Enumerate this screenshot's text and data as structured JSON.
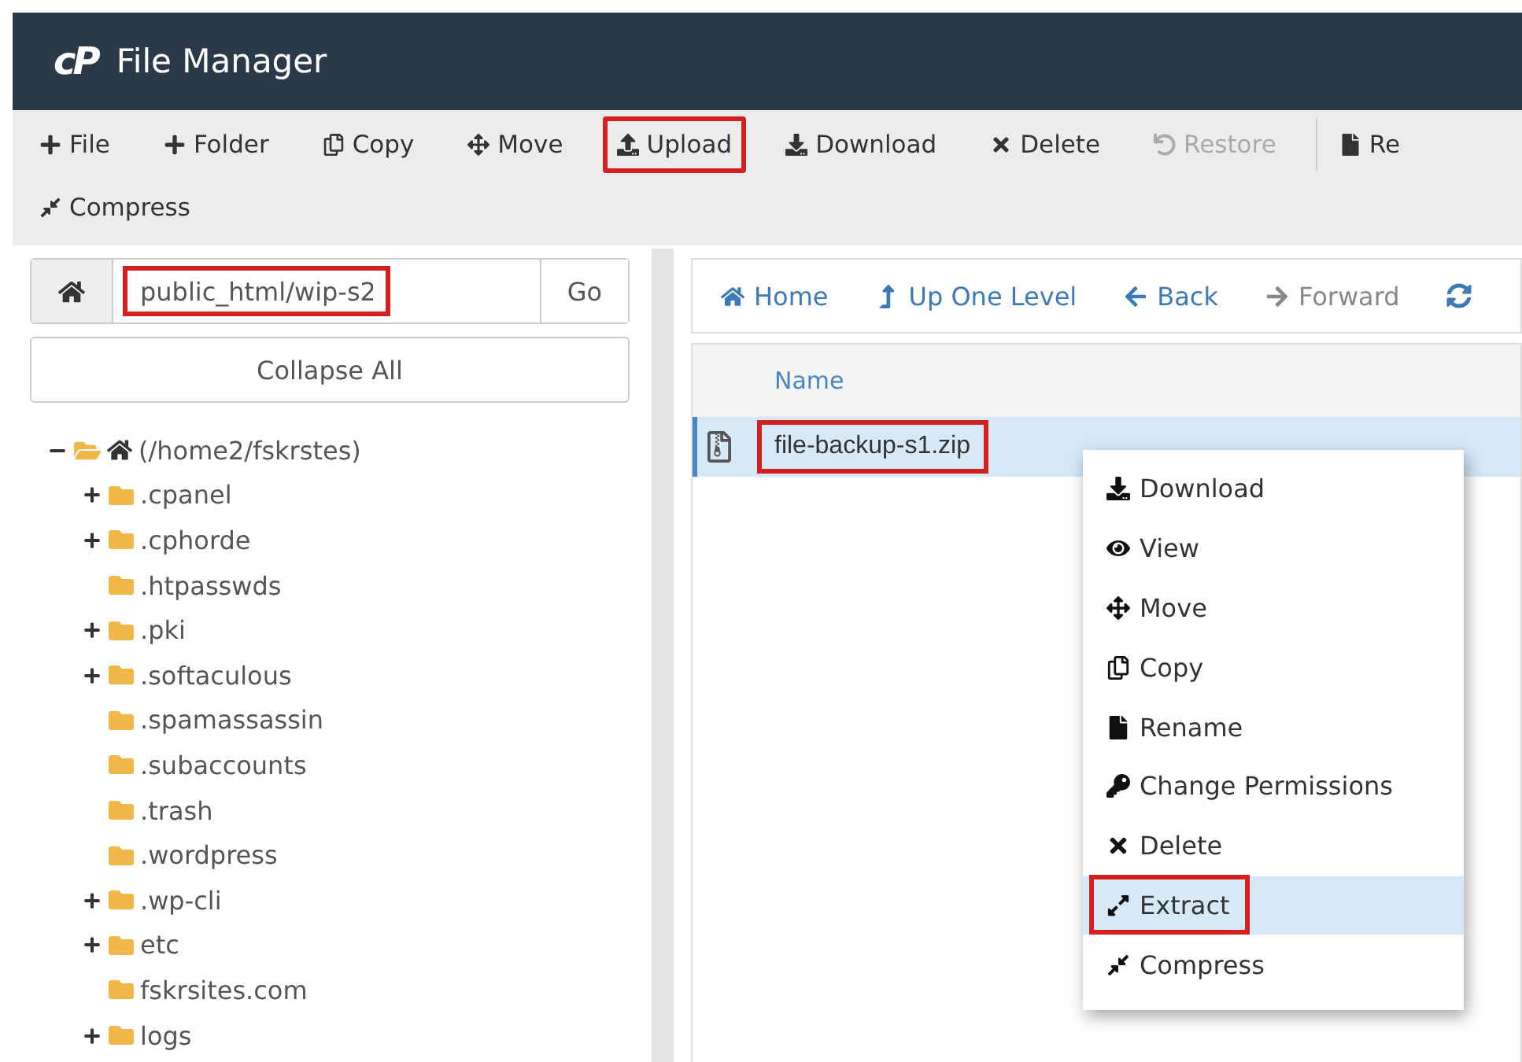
{
  "header": {
    "logo": "cP",
    "title": "File Manager"
  },
  "toolbar": [
    {
      "label": "File",
      "disabled": false,
      "highlighted": false
    },
    {
      "label": "Folder",
      "disabled": false,
      "highlighted": false
    },
    {
      "label": "Copy",
      "disabled": false,
      "highlighted": false
    },
    {
      "label": "Move",
      "disabled": false,
      "highlighted": false
    },
    {
      "label": "Upload",
      "disabled": false,
      "highlighted": true
    },
    {
      "label": "Download",
      "disabled": false,
      "highlighted": false
    },
    {
      "label": "Delete",
      "disabled": false,
      "highlighted": false
    },
    {
      "label": "Restore",
      "disabled": true,
      "highlighted": false
    },
    {
      "label": "Re",
      "disabled": false,
      "highlighted": false
    },
    {
      "label": "Compress",
      "disabled": false,
      "highlighted": false
    }
  ],
  "path": {
    "value": "public_html/wip-s2",
    "button": "Go",
    "highlighted": true
  },
  "collapse_button": "Collapse All",
  "tree": {
    "label": "(/home2/fskrstes)",
    "expanded": true,
    "children": [
      {
        "label": ".cpanel",
        "expandable": true
      },
      {
        "label": ".cphorde",
        "expandable": true
      },
      {
        "label": ".htpasswds",
        "expandable": false
      },
      {
        "label": ".pki",
        "expandable": true
      },
      {
        "label": ".softaculous",
        "expandable": true
      },
      {
        "label": ".spamassassin",
        "expandable": false
      },
      {
        "label": ".subaccounts",
        "expandable": false
      },
      {
        "label": ".trash",
        "expandable": false
      },
      {
        "label": ".wordpress",
        "expandable": false
      },
      {
        "label": ".wp-cli",
        "expandable": true
      },
      {
        "label": "etc",
        "expandable": true
      },
      {
        "label": "fskrsites.com",
        "expandable": false
      },
      {
        "label": "logs",
        "expandable": true
      }
    ]
  },
  "nav": [
    {
      "label": "Home",
      "disabled": false
    },
    {
      "label": "Up One Level",
      "disabled": false
    },
    {
      "label": "Back",
      "disabled": false
    },
    {
      "label": "Forward",
      "disabled": true
    }
  ],
  "table": {
    "columns": [
      "Name"
    ],
    "rows": [
      {
        "name": "file-backup-s1.zip",
        "selected": true,
        "highlighted": true
      }
    ]
  },
  "context_menu": [
    {
      "label": "Download",
      "selected": false,
      "highlighted": false
    },
    {
      "label": "View",
      "selected": false,
      "highlighted": false
    },
    {
      "label": "Move",
      "selected": false,
      "highlighted": false
    },
    {
      "label": "Copy",
      "selected": false,
      "highlighted": false
    },
    {
      "label": "Rename",
      "selected": false,
      "highlighted": false
    },
    {
      "label": "Change Permissions",
      "selected": false,
      "highlighted": false
    },
    {
      "label": "Delete",
      "selected": false,
      "highlighted": false
    },
    {
      "label": "Extract",
      "selected": true,
      "highlighted": true
    },
    {
      "label": "Compress",
      "selected": false,
      "highlighted": false
    }
  ]
}
